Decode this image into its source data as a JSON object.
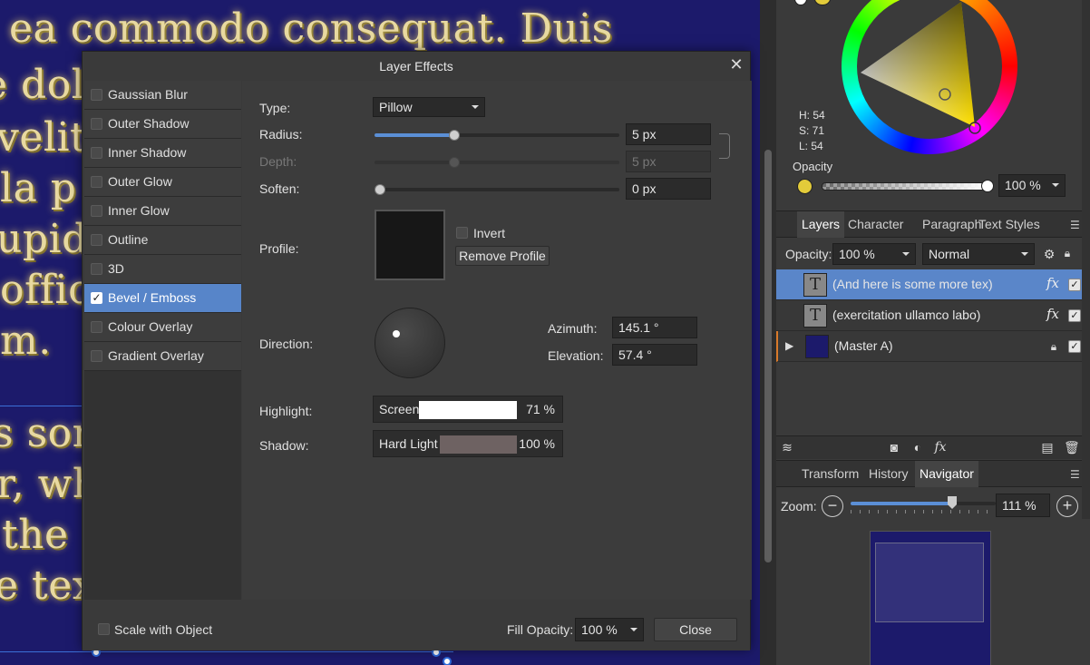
{
  "canvas": {
    "text_lines": [
      "ea commodo consequat. Duis",
      "e dol",
      "velit",
      "la p",
      "upid",
      "offic",
      "m.",
      "s son",
      "r, wh",
      "the",
      "e tex"
    ]
  },
  "dialog": {
    "title": "Layer Effects",
    "effects": [
      {
        "label": "Gaussian Blur",
        "checked": false
      },
      {
        "label": "Outer Shadow",
        "checked": false
      },
      {
        "label": "Inner Shadow",
        "checked": false
      },
      {
        "label": "Outer Glow",
        "checked": false
      },
      {
        "label": "Inner Glow",
        "checked": false
      },
      {
        "label": "Outline",
        "checked": false
      },
      {
        "label": "3D",
        "checked": false
      },
      {
        "label": "Bevel / Emboss",
        "checked": true
      },
      {
        "label": "Colour Overlay",
        "checked": false
      },
      {
        "label": "Gradient Overlay",
        "checked": false
      }
    ],
    "type_label": "Type:",
    "type_value": "Pillow",
    "radius_label": "Radius:",
    "radius_value": "5 px",
    "depth_label": "Depth:",
    "depth_value": "5 px",
    "soften_label": "Soften:",
    "soften_value": "0 px",
    "profile_label": "Profile:",
    "invert_label": "Invert",
    "remove_profile_label": "Remove Profile",
    "direction_label": "Direction:",
    "azimuth_label": "Azimuth:",
    "azimuth_value": "145.1 °",
    "elevation_label": "Elevation:",
    "elevation_value": "57.4 °",
    "highlight_label": "Highlight:",
    "highlight_mode": "Screen",
    "highlight_pct": "71 %",
    "highlight_color": "#ffffff",
    "shadow_label": "Shadow:",
    "shadow_mode": "Hard Light",
    "shadow_pct": "100 %",
    "shadow_color": "#6e6262",
    "scale_with_object_label": "Scale with Object",
    "fill_opacity_label": "Fill Opacity:",
    "fill_opacity_value": "100 %",
    "close_label": "Close"
  },
  "color_panel": {
    "h": "H: 54",
    "s": "S: 71",
    "l": "L: 54",
    "opacity_label": "Opacity",
    "opacity_value": "100 %",
    "current_color": "#e3cb3a"
  },
  "layers_panel": {
    "tabs": [
      "Layers",
      "Character",
      "Paragraph",
      "Text Styles"
    ],
    "active_tab": "Layers",
    "opacity_label": "Opacity:",
    "opacity_value": "100 %",
    "blend_mode": "Normal",
    "layers": [
      {
        "name": "(And here is some more tex)",
        "selected": true,
        "fx": true
      },
      {
        "name": "(exercitation ullamco labo)",
        "selected": false,
        "fx": true
      },
      {
        "name": "(Master A)",
        "selected": false,
        "fx": false
      }
    ]
  },
  "navigator_panel": {
    "tabs": [
      "Transform",
      "History",
      "Navigator"
    ],
    "active_tab": "Navigator",
    "zoom_label": "Zoom:",
    "zoom_value": "111 %"
  },
  "accent_color": "#5785c9"
}
